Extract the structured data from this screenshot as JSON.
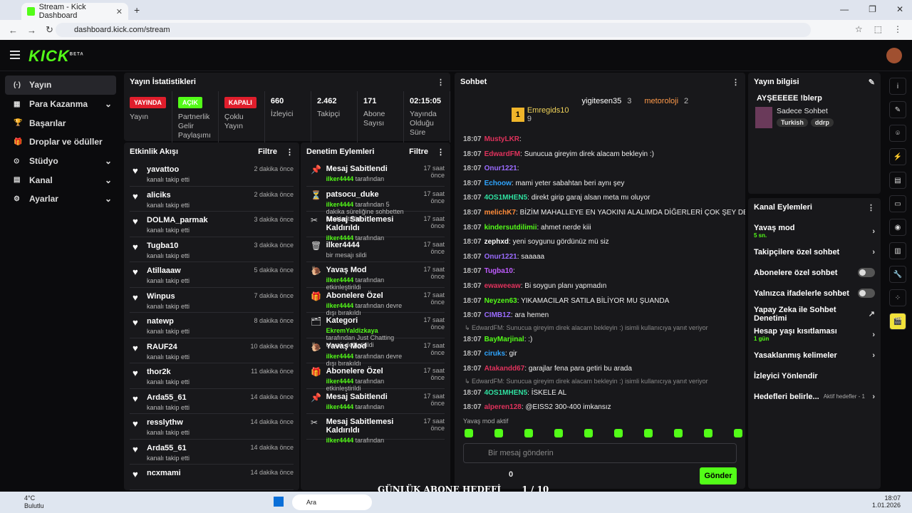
{
  "browser": {
    "tab_title": "Stream - Kick Dashboard",
    "url": "dashboard.kick.com/stream"
  },
  "logo": "KICK",
  "logo_tag": "BETA",
  "sidebar": [
    {
      "label": "Yayın",
      "active": true
    },
    {
      "label": "Para Kazanma",
      "chev": true
    },
    {
      "label": "Başarılar"
    },
    {
      "label": "Droplar ve ödüller"
    },
    {
      "label": "Stüdyo",
      "chev": true
    },
    {
      "label": "Kanal",
      "chev": true
    },
    {
      "label": "Ayarlar",
      "chev": true
    }
  ],
  "stats": {
    "title": "Yayın İstatistikleri",
    "items": [
      {
        "badge": "YAYINDA",
        "badge_bg": "#e01e2c",
        "badge_fg": "#fff",
        "label": "Yayın"
      },
      {
        "badge": "AÇIK",
        "badge_bg": "#53fc18",
        "badge_fg": "#fff",
        "label": "Partnerlik Gelir Paylaşımı"
      },
      {
        "badge": "KAPALI",
        "badge_bg": "#e01e2c",
        "badge_fg": "#fff",
        "label": "Çoklu Yayın"
      },
      {
        "value": "660",
        "label": "İzleyici"
      },
      {
        "value": "2.462",
        "label": "Takipçi"
      },
      {
        "value": "171",
        "label": "Abone Sayısı"
      },
      {
        "value": "02:15:05",
        "label": "Yayında Olduğu Süre"
      }
    ]
  },
  "activity": {
    "title": "Etkinlik Akışı",
    "filter": "Filtre",
    "items": [
      {
        "name": "yavattoo",
        "sub": "kanalı takip etti",
        "time": "2 dakika önce"
      },
      {
        "name": "aliciks",
        "sub": "kanalı takip etti",
        "time": "2 dakika önce"
      },
      {
        "name": "DOLMA_parmak",
        "sub": "kanalı takip etti",
        "time": "3 dakika önce"
      },
      {
        "name": "Tugba10",
        "sub": "kanalı takip etti",
        "time": "3 dakika önce"
      },
      {
        "name": "Atillaaaw",
        "sub": "kanalı takip etti",
        "time": "5 dakika önce"
      },
      {
        "name": "Winpus",
        "sub": "kanalı takip etti",
        "time": "7 dakika önce"
      },
      {
        "name": "natewp",
        "sub": "kanalı takip etti",
        "time": "8 dakika önce"
      },
      {
        "name": "RAUF24",
        "sub": "kanalı takip etti",
        "time": "10 dakika önce"
      },
      {
        "name": "thor2k",
        "sub": "kanalı takip etti",
        "time": "11 dakika önce"
      },
      {
        "name": "Arda55_61",
        "sub": "kanalı takip etti",
        "time": "14 dakika önce"
      },
      {
        "name": "resslythw",
        "sub": "kanalı takip etti",
        "time": "14 dakika önce"
      },
      {
        "name": "Arda55_61",
        "sub": "kanalı takip etti",
        "time": "14 dakika önce"
      },
      {
        "name": "ncxmami",
        "sub": "",
        "time": "14 dakika önce"
      }
    ]
  },
  "moderation": {
    "title": "Denetim Eylemleri",
    "filter": "Filtre",
    "items": [
      {
        "icon": "📌",
        "name": "Mesaj Sabitlendi",
        "user": "ilker4444",
        "sub": " tarafından",
        "time": "17 saat önce"
      },
      {
        "icon": "⏳",
        "name": "patsocu_duke",
        "user": "ilker4444",
        "sub": " tarafından 5 dakika süreliğine sohbetten uzaklaştırıldı",
        "time": "17 saat önce"
      },
      {
        "icon": "✂",
        "name": "Mesaj Sabitlemesi Kaldırıldı",
        "user": "ilker4444",
        "sub": " tarafından",
        "time": "17 saat önce"
      },
      {
        "icon": "🗑",
        "name": "ilker4444",
        "user": "",
        "sub": "bir mesajı sildi",
        "time": "17 saat önce"
      },
      {
        "icon": "🐌",
        "name": "Yavaş Mod",
        "user": "ilker4444",
        "sub": " tarafından etkinleştirildi",
        "time": "17 saat önce"
      },
      {
        "icon": "🎁",
        "name": "Abonelere Özel",
        "user": "ilker4444",
        "sub": " tarafından devre dışı bırakıldı",
        "time": "17 saat önce"
      },
      {
        "icon": "🗂",
        "name": "Kategori",
        "user": "EkremYaldizkaya",
        "sub": " tarafından Just Chatting olarak değiştirildi",
        "time": "17 saat önce"
      },
      {
        "icon": "🐌",
        "name": "Yavaş Mod",
        "user": "ilker4444",
        "sub": " tarafından devre dışı bırakıldı",
        "time": "17 saat önce"
      },
      {
        "icon": "🎁",
        "name": "Abonelere Özel",
        "user": "ilker4444",
        "sub": " tarafından etkinleştirildi",
        "time": "17 saat önce"
      },
      {
        "icon": "📌",
        "name": "Mesaj Sabitlendi",
        "user": "ilker4444",
        "sub": " tarafından",
        "time": "17 saat önce"
      },
      {
        "icon": "✂",
        "name": "Mesaj Sabitlemesi Kaldırıldı",
        "user": "ilker4444",
        "sub": " tarafından",
        "time": "17 saat önce"
      }
    ]
  },
  "chat": {
    "title": "Sohbet",
    "gifters": [
      {
        "name": "Emregids10",
        "count": "9",
        "rank": "1"
      },
      {
        "name": "yigitesen35",
        "count": "3"
      },
      {
        "name": "metoroloji",
        "count": "2"
      }
    ],
    "lines": [
      {
        "t": "18:07",
        "u": "MustyLKR",
        "c": "#e0325c",
        "m": ""
      },
      {
        "t": "18:07",
        "u": "EdwardFM",
        "c": "#e0325c",
        "m": "Sunucua gireyim direk alacam bekleyin :)"
      },
      {
        "t": "18:07",
        "u": "Onur1221",
        "c": "#9b6cff",
        "m": ""
      },
      {
        "t": "18:07",
        "u": "Echoow",
        "c": "#2fa5ff",
        "m": "mami yeter sabahtan beri aynı şey"
      },
      {
        "t": "18:07",
        "u": "4OS1MHEN5",
        "c": "#2fe0a0",
        "m": "direkt girip garaj alsan meta mı oluyor"
      },
      {
        "t": "18:07",
        "u": "melichK7",
        "c": "#ff8c3a",
        "m": "BİZİM MAHALLEYE EN YAOKINI ALALIMDA DİĞERLERİ ÇOK ŞEY DEĞİL"
      },
      {
        "t": "18:07",
        "u": "kindersutdilimii",
        "c": "#53fc18",
        "m": "ahmet nerde kiii"
      },
      {
        "t": "18:07",
        "u": "zephxd",
        "c": "#fff",
        "m": "yeni soygunu gördünüz mü siz"
      },
      {
        "t": "18:07",
        "u": "Onur1221",
        "c": "#9b6cff",
        "m": "saaaaa"
      },
      {
        "t": "18:07",
        "u": "Tugba10",
        "c": "#c05cff",
        "m": ""
      },
      {
        "t": "18:07",
        "u": "ewaweeaw",
        "c": "#e0325c",
        "m": "Bi soygun planı yapmadın"
      },
      {
        "t": "18:07",
        "u": "Neyzen63",
        "c": "#53fc18",
        "m": "YIKAMACILAR SATILA BİLİYOR MU ŞUANDA"
      },
      {
        "t": "18:07",
        "u": "CIMB1Z",
        "c": "#9b6cff",
        "m": "ara hemen"
      },
      {
        "reply": "↳ EdwardFM: Sunucua gireyim direk alacam bekleyin :) isimli kullanıcıya yanıt veriyor"
      },
      {
        "t": "18:07",
        "u": "BayMarjinal",
        "c": "#53fc18",
        "m": ":)"
      },
      {
        "t": "18:07",
        "u": "ciruks",
        "c": "#2fa5ff",
        "m": "gir"
      },
      {
        "t": "18:07",
        "u": "Atakandd67",
        "c": "#e0325c",
        "m": "garajlar fena para getiri bu arada"
      },
      {
        "reply": "↳ EdwardFM: Sunucua gireyim direk alacam bekleyin :) isimli kullanıcıya yanıt veriyor"
      },
      {
        "t": "18:07",
        "u": "4OS1MHEN5",
        "c": "#2fe0a0",
        "m": "İSKELE AL"
      },
      {
        "t": "18:07",
        "u": "alperen128",
        "c": "#e0325c",
        "m": "@EISS2 300-400 imkansız"
      }
    ],
    "slow_mode": "Yavaş mod aktif",
    "placeholder": "Bir mesaj gönderin",
    "send": "Gönder",
    "points": "0"
  },
  "info": {
    "title": "Yayın bilgisi",
    "stream_title": "AYŞEEEEE !blerp",
    "category": "Sadece Sohbet",
    "tags": [
      "Turkish",
      "ddrp"
    ]
  },
  "actions": {
    "title": "Kanal Eylemleri",
    "items": [
      {
        "label": "Yavaş mod",
        "sub": "5 sn.",
        "kind": "chev"
      },
      {
        "label": "Takipçilere özel sohbet",
        "kind": "chev"
      },
      {
        "label": "Abonelere özel sohbet",
        "kind": "toggle"
      },
      {
        "label": "Yalnızca ifadelerle sohbet",
        "kind": "toggle"
      },
      {
        "label": "Yapay Zeka ile Sohbet Denetimi",
        "kind": "ext"
      },
      {
        "label": "Hesap yaşı kısıtlaması",
        "sub": "1 gün",
        "kind": "chev"
      },
      {
        "label": "Yasaklanmış kelimeler",
        "kind": "chev"
      },
      {
        "label": "İzleyici Yönlendir",
        "kind": "none"
      },
      {
        "label": "Hedefleri belirle...",
        "extra": "Aktif hedefler - 1",
        "kind": "chev"
      }
    ]
  },
  "overlay": {
    "text": "GÜNLÜK ABONE HEDEFİ",
    "count": "1 / 10"
  },
  "taskbar": {
    "temp": "4°C",
    "weather": "Bulutlu",
    "search": "Ara",
    "time": "18:07",
    "date": "1.01.2026"
  }
}
